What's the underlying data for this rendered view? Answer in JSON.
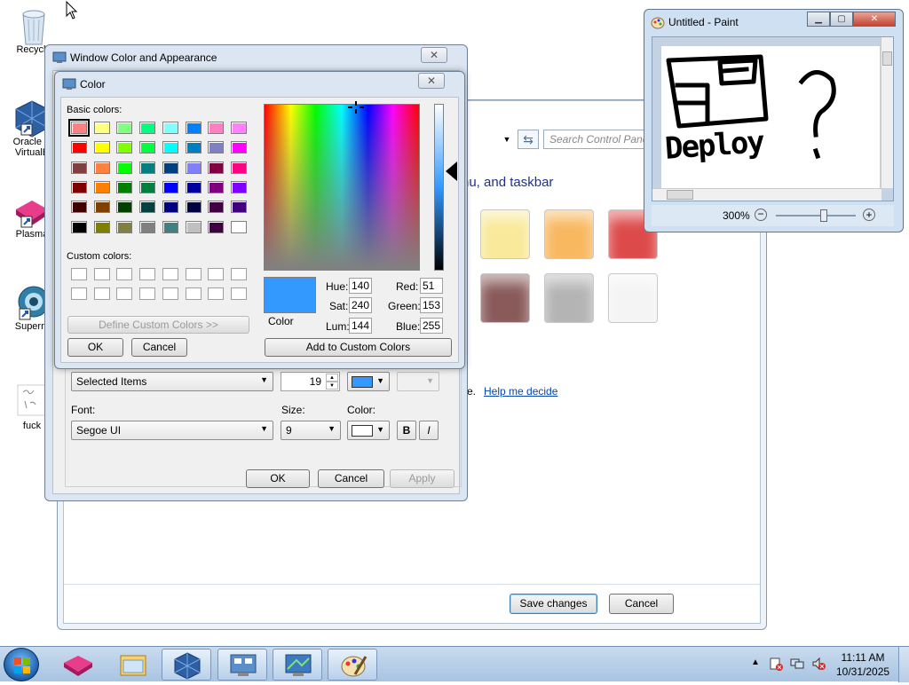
{
  "desktop": {
    "icons": [
      {
        "label": "Recycle"
      },
      {
        "label": "Oracle V VirtualB"
      },
      {
        "label": "Plasma"
      },
      {
        "label": "Superm"
      },
      {
        "label": "fuck"
      }
    ]
  },
  "control_panel": {
    "search_placeholder": "Search Control Panel",
    "heading_fragment": "nu, and taskbar",
    "help_prefix": "ce.",
    "help_link": "Help me decide",
    "save_button": "Save changes",
    "cancel_button": "Cancel",
    "swatches": [
      "#f9e99a",
      "#f8b860",
      "#dd4a4a",
      "#8a5a5a",
      "#b4b4b4",
      "#f4f4f4"
    ]
  },
  "window_color": {
    "title": "Window Color and Appearance",
    "item_value": "Selected Items",
    "size_value": "19",
    "color1": "#3399ff",
    "font_label": "Font:",
    "size_label": "Size:",
    "color_label": "Color:",
    "font_value": "Segoe UI",
    "font_size_value": "9",
    "bold_label": "B",
    "italic_label": "I",
    "ok_button": "OK",
    "cancel_button": "Cancel",
    "apply_button": "Apply"
  },
  "color_dialog": {
    "title": "Color",
    "basic_colors_label": "Basic colors:",
    "custom_colors_label": "Custom colors:",
    "define_custom_button": "Define Custom Colors >>",
    "ok_button": "OK",
    "cancel_button": "Cancel",
    "add_custom_button": "Add to Custom Colors",
    "color_label": "Color",
    "hue_label": "Hue:",
    "sat_label": "Sat:",
    "lum_label": "Lum:",
    "red_label": "Red:",
    "green_label": "Green:",
    "blue_label": "Blue:",
    "hue": "140",
    "sat": "240",
    "lum": "144",
    "red": "51",
    "green": "153",
    "blue": "255",
    "selected_color": "#3399ff",
    "basic_colors": [
      [
        "#ff8080",
        "#ffff80",
        "#80ff80",
        "#00ff80",
        "#80ffff",
        "#0080ff",
        "#ff80c0",
        "#ff80ff"
      ],
      [
        "#ff0000",
        "#ffff00",
        "#80ff00",
        "#00ff40",
        "#00ffff",
        "#0080c0",
        "#8080c0",
        "#ff00ff"
      ],
      [
        "#804040",
        "#ff8040",
        "#00ff00",
        "#008080",
        "#004080",
        "#8080ff",
        "#800040",
        "#ff0080"
      ],
      [
        "#800000",
        "#ff8000",
        "#008000",
        "#008040",
        "#0000ff",
        "#0000a0",
        "#800080",
        "#8000ff"
      ],
      [
        "#400000",
        "#804000",
        "#004000",
        "#004040",
        "#000080",
        "#000040",
        "#400040",
        "#400080"
      ],
      [
        "#000000",
        "#808000",
        "#808040",
        "#808080",
        "#408080",
        "#c0c0c0",
        "#400040",
        "#ffffff"
      ]
    ]
  },
  "paint": {
    "title": "Untitled - Paint",
    "canvas_text": "Deploy",
    "zoom": "300%"
  },
  "taskbar": {
    "time": "11:11 AM",
    "date": "10/31/2025"
  }
}
